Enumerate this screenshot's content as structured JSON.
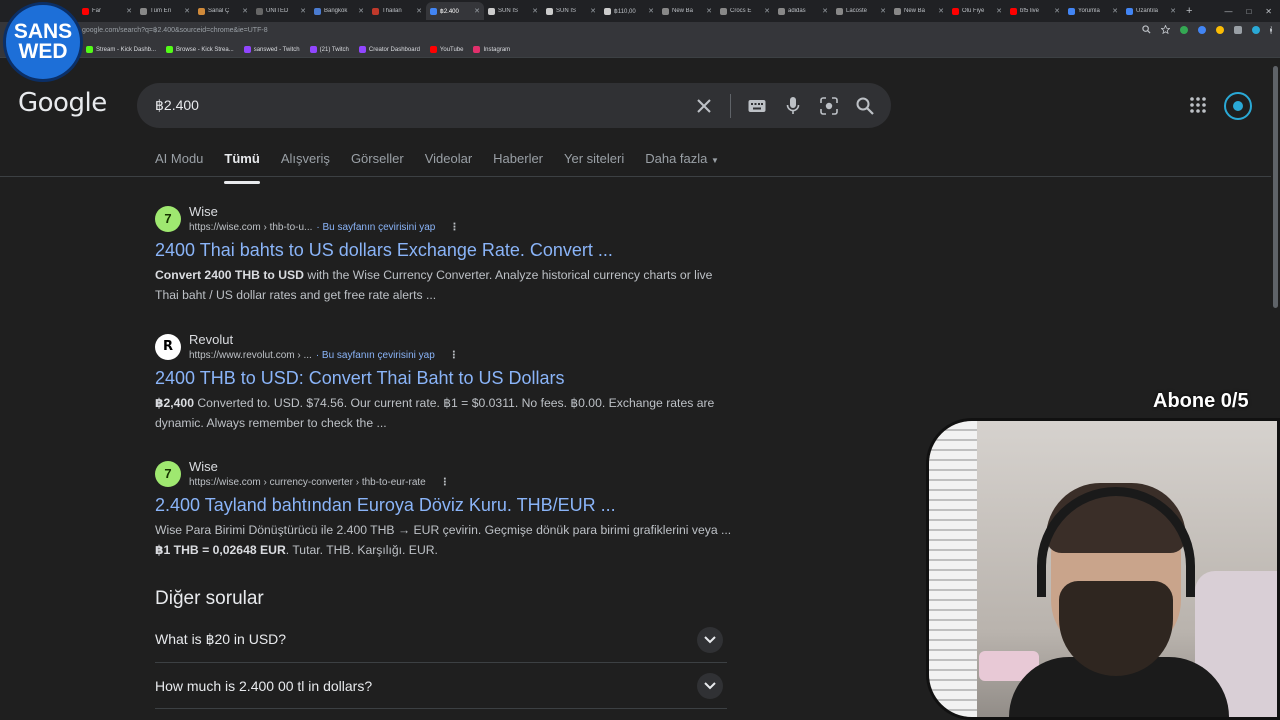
{
  "browser": {
    "tabs": [
      {
        "title": "Far",
        "color": "#ff0000",
        "active": false
      },
      {
        "title": "Tüm Eri",
        "color": "#888888",
        "active": false
      },
      {
        "title": "Sanal Ç",
        "color": "#d08a3a",
        "active": false
      },
      {
        "title": "UNITED",
        "color": "#666666",
        "active": false
      },
      {
        "title": "Bangkok",
        "color": "#4a7bd0",
        "active": false
      },
      {
        "title": "Thailan",
        "color": "#c0392b",
        "active": false
      },
      {
        "title": "฿2.400",
        "color": "#4285f4",
        "active": true
      },
      {
        "title": "SUN İS",
        "color": "#cccccc",
        "active": false
      },
      {
        "title": "SUN İS",
        "color": "#cccccc",
        "active": false
      },
      {
        "title": "฿110,00",
        "color": "#cccccc",
        "active": false
      },
      {
        "title": "New Ba",
        "color": "#888888",
        "active": false
      },
      {
        "title": "Crocs E",
        "color": "#888888",
        "active": false
      },
      {
        "title": "adidas",
        "color": "#888888",
        "active": false
      },
      {
        "title": "Lacoste",
        "color": "#888888",
        "active": false
      },
      {
        "title": "New Ba",
        "color": "#888888",
        "active": false
      },
      {
        "title": "Ölü Fiye",
        "color": "#ff0000",
        "active": false
      },
      {
        "title": "bf5 live",
        "color": "#ff0000",
        "active": false
      },
      {
        "title": "Yorumla",
        "color": "#4285f4",
        "active": false
      },
      {
        "title": "Uzantıla",
        "color": "#4285f4",
        "active": false
      }
    ],
    "new_tab_label": "+",
    "window_controls": [
      "—",
      "□",
      "✕"
    ],
    "url_prefix": "google.com/search?q=฿2.400&sourceid=chrome&ie=UTF-8",
    "bookmarks": [
      {
        "label": "Stream - Kick Dashb...",
        "color": "#53fc18"
      },
      {
        "label": "Browse - Kick Strea...",
        "color": "#53fc18"
      },
      {
        "label": "sanswed - Twitch",
        "color": "#9146ff"
      },
      {
        "label": "(21) Twitch",
        "color": "#9146ff"
      },
      {
        "label": "Creator Dashboard",
        "color": "#9146ff"
      },
      {
        "label": "YouTube",
        "color": "#ff0000"
      },
      {
        "label": "Instagram",
        "color": "#e1306c"
      }
    ]
  },
  "overlay": {
    "logo_line1": "SANS",
    "logo_line2": "WED",
    "sub_counter": "Abone 0/5"
  },
  "google": {
    "logo": "Google",
    "query": "฿2.400",
    "nav_tabs": [
      "AI Modu",
      "Tümü",
      "Alışveriş",
      "Görseller",
      "Videolar",
      "Haberler",
      "Yer siteleri",
      "Daha fazla"
    ],
    "active_tab": "Tümü",
    "results": [
      {
        "source": "Wise",
        "icon": "wise",
        "cite": "https://wise.com › thb-to-u...",
        "translate": "· Bu sayfanın çevirisini yap",
        "title": "2400 Thai bahts to US dollars Exchange Rate. Convert ...",
        "snippet_bold": "Convert 2400 THB to USD",
        "snippet_rest": " with the Wise Currency Converter. Analyze historical currency charts or live Thai baht / US dollar rates and get free rate alerts ..."
      },
      {
        "source": "Revolut",
        "icon": "revolut",
        "cite": "https://www.revolut.com › ...",
        "translate": "· Bu sayfanın çevirisini yap",
        "title": "2400 THB to USD: Convert Thai Baht to US Dollars",
        "snippet_bold": "฿2,400",
        "snippet_rest": " Converted to. USD. $74.56. Our current rate. ฿1 = $0.0311. No fees. ฿0.00. Exchange rates are dynamic. Always remember to check the ..."
      },
      {
        "source": "Wise",
        "icon": "wise",
        "cite": "https://wise.com › currency-converter › thb-to-eur-rate",
        "translate": "",
        "title": "2.400 Tayland bahtından Euroya Döviz Kuru. THB/EUR ...",
        "snippet_pre": "Wise Para Birimi Dönüştürücü ile 2.400 THB → EUR çevirin. Geçmişe dönük para birimi grafiklerini veya ... ",
        "snippet_bold": "฿1 THB = 0,02648 EUR",
        "snippet_rest": ". Tutar. THB. Karşılığı. EUR."
      }
    ],
    "paa_title": "Diğer sorular",
    "paa": [
      "What is ฿20 in USD?",
      "How much is 2.400 00 tl in dollars?"
    ]
  }
}
